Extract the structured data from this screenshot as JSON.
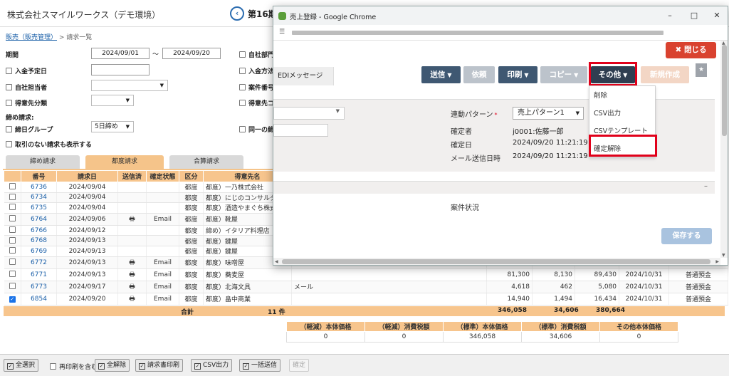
{
  "app": {
    "title": "株式会社スマイルワークス（デモ環境）",
    "period_title": "第16期",
    "back_icon": "chevron-left-circle-icon"
  },
  "breadcrumb": {
    "parent": "販売（販売管理）",
    "separator": " > ",
    "current": "請求一覧"
  },
  "filters": {
    "period_label": "期間",
    "period_from": "2024/09/01",
    "period_tilde": "～",
    "period_to": "2024/09/20",
    "payment_date_label": "入金予定日",
    "staff_label": "自社担当者",
    "customer_class_label": "得意先分類",
    "closing_header": "締め請求:",
    "closing_group_label": "締日グループ",
    "closing_group_value": "5日締め",
    "show_no_trade_label": "取引のない請求も表示する",
    "dept_label": "自社部門",
    "payment_method_label": "入金方法",
    "case_number_label": "案件番号",
    "customer_code_label": "得意先コード",
    "same_closing_label": "同一の締"
  },
  "tabs": {
    "closing": "締め請求",
    "each": "都度請求",
    "total": "合算請求"
  },
  "table": {
    "headers": [
      "",
      "番号",
      "請求日",
      "送信済",
      "確定状態",
      "区分",
      "得意先名"
    ],
    "rows": [
      {
        "checked": false,
        "no": "6736",
        "date": "2024/09/04",
        "printed": false,
        "status": "",
        "kubun": "都度",
        "customer": "都度）一乃株式会社"
      },
      {
        "checked": false,
        "no": "6734",
        "date": "2024/09/04",
        "printed": false,
        "status": "",
        "kubun": "都度",
        "customer": "都度）にじのコンサルタント"
      },
      {
        "checked": false,
        "no": "6735",
        "date": "2024/09/04",
        "printed": false,
        "status": "",
        "kubun": "都度",
        "customer": "都度）酒造やまぐち株式会社"
      },
      {
        "checked": false,
        "no": "6764",
        "date": "2024/09/06",
        "printed": true,
        "status": "Email",
        "kubun": "都度",
        "customer": "都度）靴屋"
      },
      {
        "checked": false,
        "no": "6766",
        "date": "2024/09/12",
        "printed": false,
        "status": "",
        "kubun": "都度",
        "customer": "締め）イタリア料理店"
      },
      {
        "checked": false,
        "no": "6768",
        "date": "2024/09/13",
        "printed": false,
        "status": "",
        "kubun": "都度",
        "customer": "都度）鍵屋"
      },
      {
        "checked": false,
        "no": "6769",
        "date": "2024/09/13",
        "printed": false,
        "status": "",
        "kubun": "都度",
        "customer": "都度）鍵屋"
      },
      {
        "checked": false,
        "no": "6772",
        "date": "2024/09/13",
        "printed": true,
        "status": "Email",
        "kubun": "都度",
        "customer": "都度）味噌屋"
      },
      {
        "checked": false,
        "no": "6771",
        "date": "2024/09/13",
        "printed": true,
        "status": "Email",
        "kubun": "都度",
        "customer": "都度）蕎麦屋",
        "amount": "81,300",
        "tax": "8,130",
        "total": "89,430",
        "due": "2024/10/31",
        "account": "普通預金"
      },
      {
        "checked": false,
        "no": "6773",
        "date": "2024/09/17",
        "printed": true,
        "status": "Email",
        "kubun": "都度",
        "customer": "都度）北海文具",
        "method": "メール",
        "amount": "4,618",
        "tax": "462",
        "total": "5,080",
        "due": "2024/10/31",
        "account": "普通預金"
      },
      {
        "checked": true,
        "no": "6854",
        "date": "2024/09/20",
        "printed": true,
        "status": "Email",
        "kubun": "都度",
        "customer": "都度）畠中商業",
        "amount": "14,940",
        "tax": "1,494",
        "total": "16,434",
        "due": "2024/10/31",
        "account": "普通預金"
      }
    ]
  },
  "totals": {
    "label": "合計",
    "count": "11 件",
    "amount": "346,058",
    "tax": "34,606",
    "total": "380,664"
  },
  "tax_summary": {
    "headers": [
      "（軽減）本体価格",
      "（軽減）消費税額",
      "（標準）本体価格",
      "（標準）消費税額",
      "その他本体価格"
    ],
    "values": [
      "0",
      "0",
      "346,058",
      "34,606",
      "0"
    ]
  },
  "footer": {
    "select_all": "全選択",
    "reprint": "再印刷を含む",
    "deselect_all": "全解除",
    "print_invoice": "請求書印刷",
    "csv_export": "CSV出力",
    "batch_send": "一括送信",
    "confirm": "確定"
  },
  "popup": {
    "window_title": "売上登録 - Google Chrome",
    "close_button": "✖ 閉じる",
    "edi_label": "EDIメッセージ",
    "toolbar": {
      "send": "送信",
      "request": "依頼",
      "print": "印刷",
      "copy": "コピー",
      "other": "その他",
      "new": "新規作成"
    },
    "other_menu": [
      "削除",
      "CSV出力",
      "CSVテンプレート",
      "確定解除"
    ],
    "detail": {
      "pattern_label": "連動パターン",
      "pattern_required": "*",
      "pattern_value": "売上パターン1",
      "confirmer_label": "確定者",
      "confirmer_value": "j0001:佐藤一郎",
      "confirm_date_label": "確定日",
      "confirm_date_value": "2024/09/20 11:21:19",
      "mail_sent_label": "メール送信日時",
      "mail_sent_value": "2024/09/20 11:21:19"
    },
    "collapse_icon": "minus-icon",
    "case_status_label": "案件状況",
    "save_button": "保存する"
  },
  "colors": {
    "accent_orange": "#f7c58d",
    "button_dark": "#3f5872",
    "close_red": "#d9422f",
    "highlight_red": "#e1001a",
    "link_blue": "#1a5fa8"
  }
}
